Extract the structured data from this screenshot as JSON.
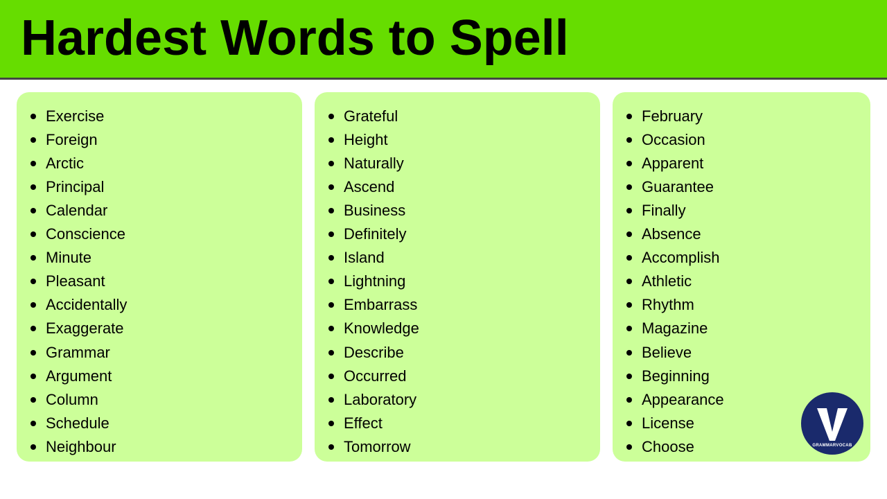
{
  "header": {
    "title": "Hardest Words to Spell",
    "bg_color": "#66dd00"
  },
  "columns": [
    {
      "id": "col1",
      "words": [
        "Exercise",
        "Foreign",
        "Arctic",
        "Principal",
        "Calendar",
        "Conscience",
        "Minute",
        "Pleasant",
        "Accidentally",
        "Exaggerate",
        "Grammar",
        "Argument",
        "Column",
        "Schedule",
        "Neighbour"
      ]
    },
    {
      "id": "col2",
      "words": [
        "Grateful",
        "Height",
        "Naturally",
        "Ascend",
        "Business",
        "Definitely",
        "Island",
        "Lightning",
        "Embarrass",
        "Knowledge",
        "Describe",
        "Occurred",
        "Laboratory",
        "Effect",
        "Tomorrow"
      ]
    },
    {
      "id": "col3",
      "words": [
        "February",
        "Occasion",
        "Apparent",
        "Guarantee",
        "Finally",
        "Absence",
        "Accomplish",
        "Athletic",
        "Rhythm",
        "Magazine",
        "Believe",
        "Beginning",
        "Appearance",
        "License",
        "Choose"
      ]
    }
  ],
  "logo": {
    "letter": "V",
    "brand": "GRAMMARVOCAB"
  }
}
